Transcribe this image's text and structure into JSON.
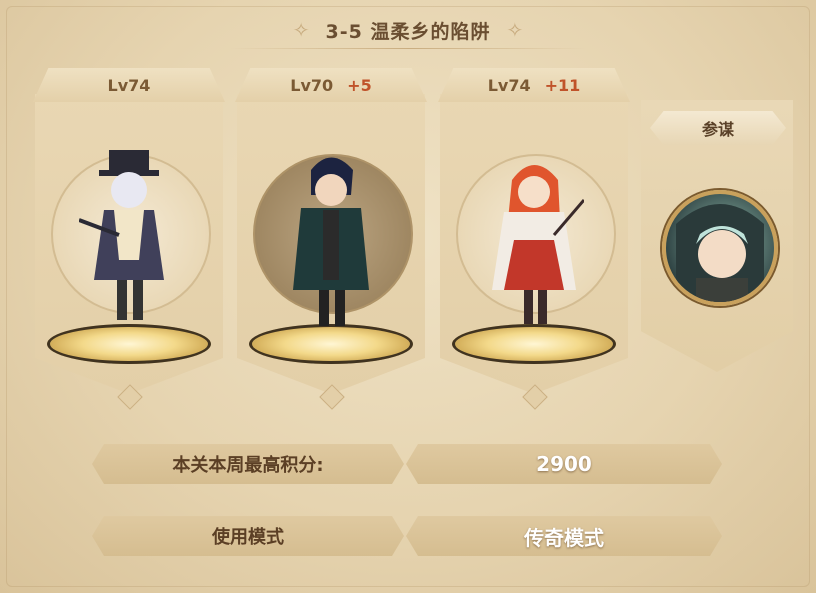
{
  "stage": {
    "title": "3-5 温柔乡的陷阱"
  },
  "heroes": [
    {
      "level": "Lv74",
      "bonus": ""
    },
    {
      "level": "Lv70",
      "bonus": "+5"
    },
    {
      "level": "Lv74",
      "bonus": "+11"
    }
  ],
  "advisor": {
    "label": "参谋"
  },
  "score": {
    "label": "本关本周最高积分:",
    "value": "2900"
  },
  "modes": {
    "use_mode": "使用模式",
    "legend_mode": "传奇模式"
  },
  "colors": {
    "bonus": "#c0532a",
    "level": "#7b5a34",
    "accent_gold": "#c9a15c"
  }
}
